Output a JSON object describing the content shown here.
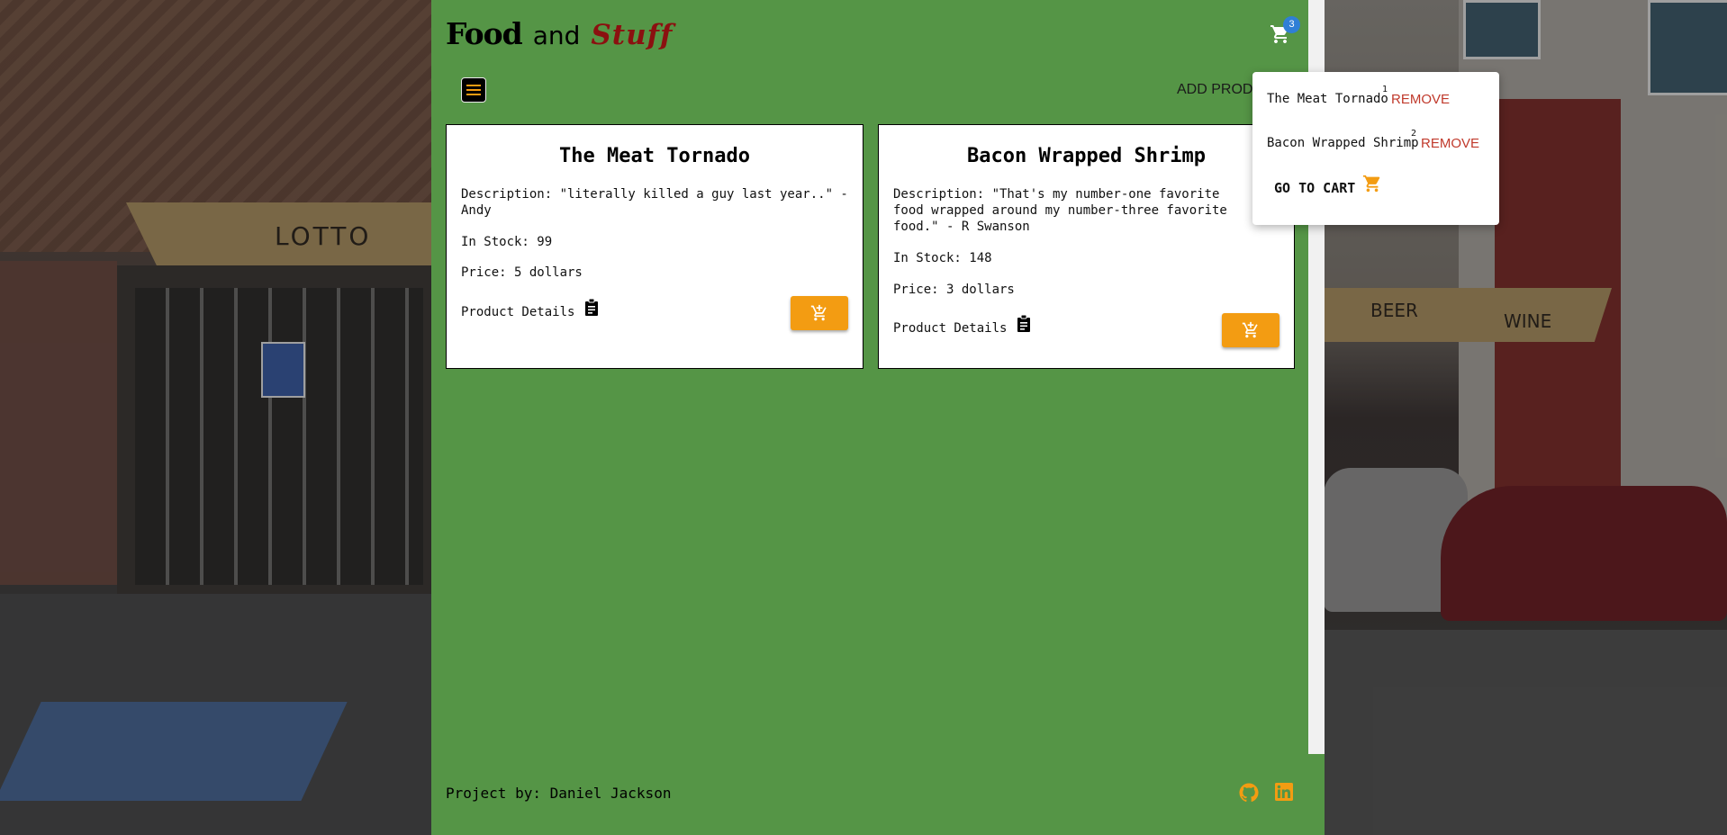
{
  "header": {
    "logo_food": "Food",
    "logo_and": "and",
    "logo_stuff": "Stuff",
    "cart_badge_count": "3",
    "cart_icon": "shopping-cart-icon"
  },
  "nav": {
    "menu_icon": "hamburger-menu-icon",
    "add_product_label": "ADD PRODU"
  },
  "products": [
    {
      "title": "The Meat Tornado",
      "description": "Description: \"literally killed a guy last year..\" - Andy",
      "stock": "In Stock: 99",
      "price": "Price: 5 dollars",
      "details_label": "Product Details"
    },
    {
      "title": "Bacon Wrapped Shrimp",
      "description": "Description: \"That's my number-one favorite food wrapped around my number-three favorite food.\" - R Swanson",
      "stock": "In Stock: 148",
      "price": "Price: 3 dollars",
      "details_label": "Product Details"
    }
  ],
  "cart_dropdown": {
    "items": [
      {
        "name": "The Meat Tornado",
        "qty": "1",
        "remove_label": "REMOVE"
      },
      {
        "name": "Bacon Wrapped Shrimp",
        "qty": "2",
        "remove_label": "REMOVE"
      }
    ],
    "go_to_cart_label": "GO TO CART"
  },
  "footer": {
    "credit": "Project by: Daniel Jackson",
    "icons": [
      "github-icon",
      "linkedin-icon"
    ]
  },
  "colors": {
    "main_bg": "#559546",
    "accent": "#f39c12",
    "badge": "#2f7fd6",
    "remove": "#c0392b",
    "logo_stuff": "#8b1010"
  }
}
